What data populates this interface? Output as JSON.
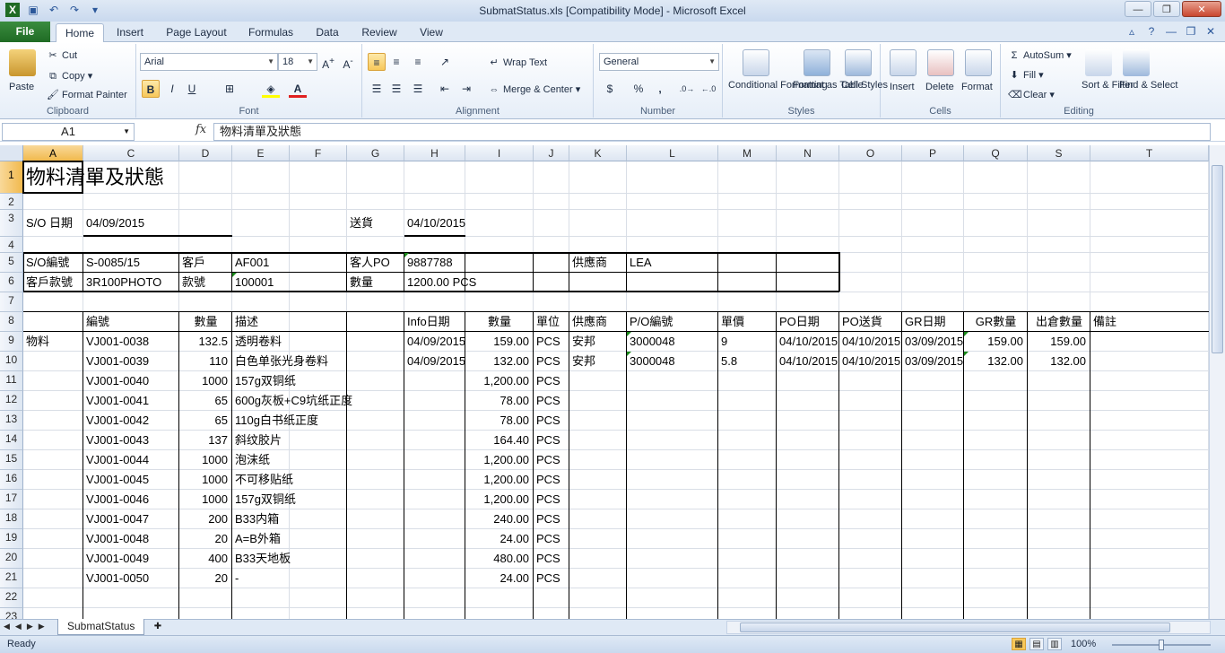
{
  "window": {
    "title": "SubmatStatus.xls  [Compatibility Mode]  -  Microsoft Excel",
    "controls": [
      "minimize-icon",
      "restore-icon",
      "close-icon"
    ]
  },
  "ribbon_tabs": [
    "File",
    "Home",
    "Insert",
    "Page Layout",
    "Formulas",
    "Data",
    "Review",
    "View"
  ],
  "active_tab": "Home",
  "ribbon": {
    "clipboard": {
      "label": "Clipboard",
      "paste": "Paste",
      "cut": "Cut",
      "copy": "Copy",
      "format_painter": "Format Painter"
    },
    "font": {
      "label": "Font",
      "font_name": "Arial",
      "font_size": "18",
      "bold": "B",
      "italic": "I",
      "underline": "U"
    },
    "alignment": {
      "label": "Alignment",
      "wrap_text": "Wrap Text",
      "merge_center": "Merge & Center"
    },
    "number": {
      "label": "Number",
      "format": "General",
      "currency": "$",
      "percent": "%",
      "comma": ","
    },
    "styles": {
      "label": "Styles",
      "conditional": "Conditional Formatting",
      "format_table": "Format as Table",
      "cell_styles": "Cell Styles"
    },
    "cells": {
      "label": "Cells",
      "insert": "Insert",
      "delete": "Delete",
      "format": "Format"
    },
    "editing": {
      "label": "Editing",
      "autosum": "AutoSum",
      "fill": "Fill",
      "clear": "Clear",
      "sort_filter": "Sort & Filter",
      "find_select": "Find & Select"
    }
  },
  "formula_bar": {
    "name_box": "A1",
    "fx": "fx",
    "formula": "物料清單及狀態"
  },
  "columns": [
    "A",
    "C",
    "D",
    "E",
    "F",
    "G",
    "H",
    "I",
    "J",
    "K",
    "L",
    "M",
    "N",
    "O",
    "P",
    "Q",
    "S",
    "T"
  ],
  "rows": [
    "1",
    "2",
    "3",
    "4",
    "5",
    "6",
    "7",
    "8",
    "9",
    "10",
    "11",
    "12",
    "13",
    "14",
    "15",
    "16",
    "17",
    "18",
    "19",
    "20",
    "21",
    "22",
    "23"
  ],
  "sheet": {
    "title": "物料清單及狀態",
    "so_date_label": "S/O 日期",
    "so_date": "04/09/2015",
    "delivery_label": "送貨",
    "delivery_date": "04/10/2015",
    "so_no_label": "S/O編號",
    "so_no": "S-0085/15",
    "customer_label": "客戶",
    "customer": "AF001",
    "customer_po_label": "客人PO",
    "customer_po": "9887788",
    "supplier_label": "供應商",
    "supplier": "LEA",
    "cust_style_label": "客戶款號",
    "cust_style": "3R100PHOTO",
    "style_label": "款號",
    "style": "100001",
    "qty_label": "數量",
    "qty": "1200.00 PCS",
    "headers": [
      "編號",
      "數量",
      "描述",
      "Info日期",
      "數量",
      "單位",
      "供應商",
      "P/O編號",
      "單價",
      "PO日期",
      "PO送貨",
      "GR日期",
      "GR數量",
      "出倉數量",
      "備註"
    ],
    "category": "物料",
    "items": [
      {
        "code": "VJ001-0038",
        "qty": "132.5",
        "desc": "透明卷料",
        "info_date": "04/09/2015",
        "amount": "159.00",
        "unit": "PCS",
        "supplier": "安邦",
        "po_no": "3000048",
        "price": "9",
        "po_date": "04/10/2015",
        "po_delivery": "04/10/2015",
        "gr_date": "03/09/2015",
        "gr_qty": "159.00",
        "out_qty": "159.00"
      },
      {
        "code": "VJ001-0039",
        "qty": "110",
        "desc": "白色单张光身卷料",
        "info_date": "04/09/2015",
        "amount": "132.00",
        "unit": "PCS",
        "supplier": "安邦",
        "po_no": "3000048",
        "price": "5.8",
        "po_date": "04/10/2015",
        "po_delivery": "04/10/2015",
        "gr_date": "03/09/2015",
        "gr_qty": "132.00",
        "out_qty": "132.00"
      },
      {
        "code": "VJ001-0040",
        "qty": "1000",
        "desc": "157g双铜纸",
        "amount": "1,200.00",
        "unit": "PCS"
      },
      {
        "code": "VJ001-0041",
        "qty": "65",
        "desc": "600g灰板+C9坑纸正度",
        "amount": "78.00",
        "unit": "PCS"
      },
      {
        "code": "VJ001-0042",
        "qty": "65",
        "desc": "110g白书纸正度",
        "amount": "78.00",
        "unit": "PCS"
      },
      {
        "code": "VJ001-0043",
        "qty": "137",
        "desc": "斜纹胶片",
        "amount": "164.40",
        "unit": "PCS"
      },
      {
        "code": "VJ001-0044",
        "qty": "1000",
        "desc": "泡沫纸",
        "amount": "1,200.00",
        "unit": "PCS"
      },
      {
        "code": "VJ001-0045",
        "qty": "1000",
        "desc": "不可移贴纸",
        "amount": "1,200.00",
        "unit": "PCS"
      },
      {
        "code": "VJ001-0046",
        "qty": "1000",
        "desc": "157g双铜纸",
        "amount": "1,200.00",
        "unit": "PCS"
      },
      {
        "code": "VJ001-0047",
        "qty": "200",
        "desc": "B33内箱",
        "amount": "240.00",
        "unit": "PCS"
      },
      {
        "code": "VJ001-0048",
        "qty": "20",
        "desc": "A=B外箱",
        "amount": "24.00",
        "unit": "PCS"
      },
      {
        "code": "VJ001-0049",
        "qty": "400",
        "desc": "B33天地板",
        "amount": "480.00",
        "unit": "PCS"
      },
      {
        "code": "VJ001-0050",
        "qty": "20",
        "desc": "-",
        "amount": "24.00",
        "unit": "PCS"
      }
    ]
  },
  "sheet_tabs": [
    "SubmatStatus"
  ],
  "status": {
    "ready": "Ready",
    "zoom": "100%"
  }
}
